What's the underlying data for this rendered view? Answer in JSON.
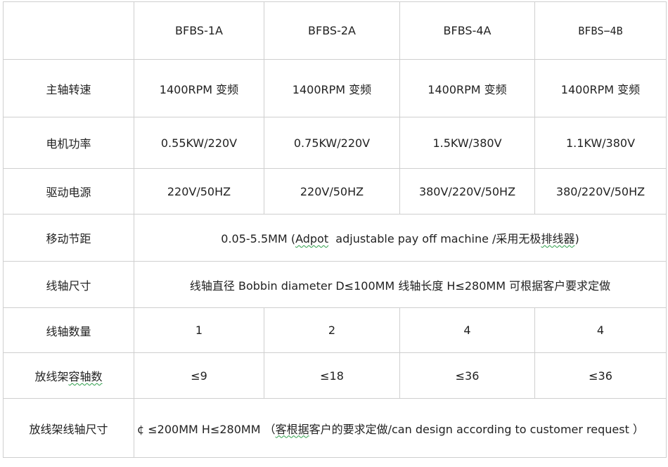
{
  "header": {
    "models": [
      "BFBS-1A",
      "BFBS-2A",
      "BFBS-4A",
      "BFBS−4B"
    ]
  },
  "rows": {
    "spindle_speed": {
      "label": "主轴转速",
      "values": [
        "1400RPM 变频",
        "1400RPM 变频",
        "1400RPM 变频",
        "1400RPM 变频"
      ]
    },
    "motor_power": {
      "label": "电机功率",
      "values": [
        "0.55KW/220V",
        "0.75KW/220V",
        "1.5KW/380V",
        "1.1KW/380V"
      ]
    },
    "power_supply": {
      "label": "驱动电源",
      "values": [
        "220V/50HZ",
        "220V/50HZ",
        "380V/220V/50HZ",
        "380/220V/50HZ"
      ]
    },
    "pitch": {
      "label": "移动节距",
      "prefix": "0.05-5.5MM (",
      "adpot": "Adpot",
      "middle": "  adjustable pay off machine /采用无极",
      "squig_word": "排线器",
      "suffix": ")"
    },
    "bobbin_size": {
      "label": "线轴尺寸",
      "value": "线轴直径 Bobbin diameter D≤100MM 线轴长度 H≤280MM 可根据客户要求定做"
    },
    "bobbin_count": {
      "label": "线轴数量",
      "values": [
        "1",
        "2",
        "4",
        "4"
      ]
    },
    "payoff_capacity": {
      "label_prefix": "放线架",
      "label_squig": "容轴数",
      "values": [
        "≤9",
        "≤18",
        "≤36",
        "≤36"
      ]
    },
    "payoff_bobbin_size": {
      "label": "放线架线轴尺寸",
      "prefix": "¢ ≤200MM H≤280MM （",
      "squig_word": "客根据",
      "suffix": "客户的要求定做/can design according to customer request ）"
    }
  }
}
